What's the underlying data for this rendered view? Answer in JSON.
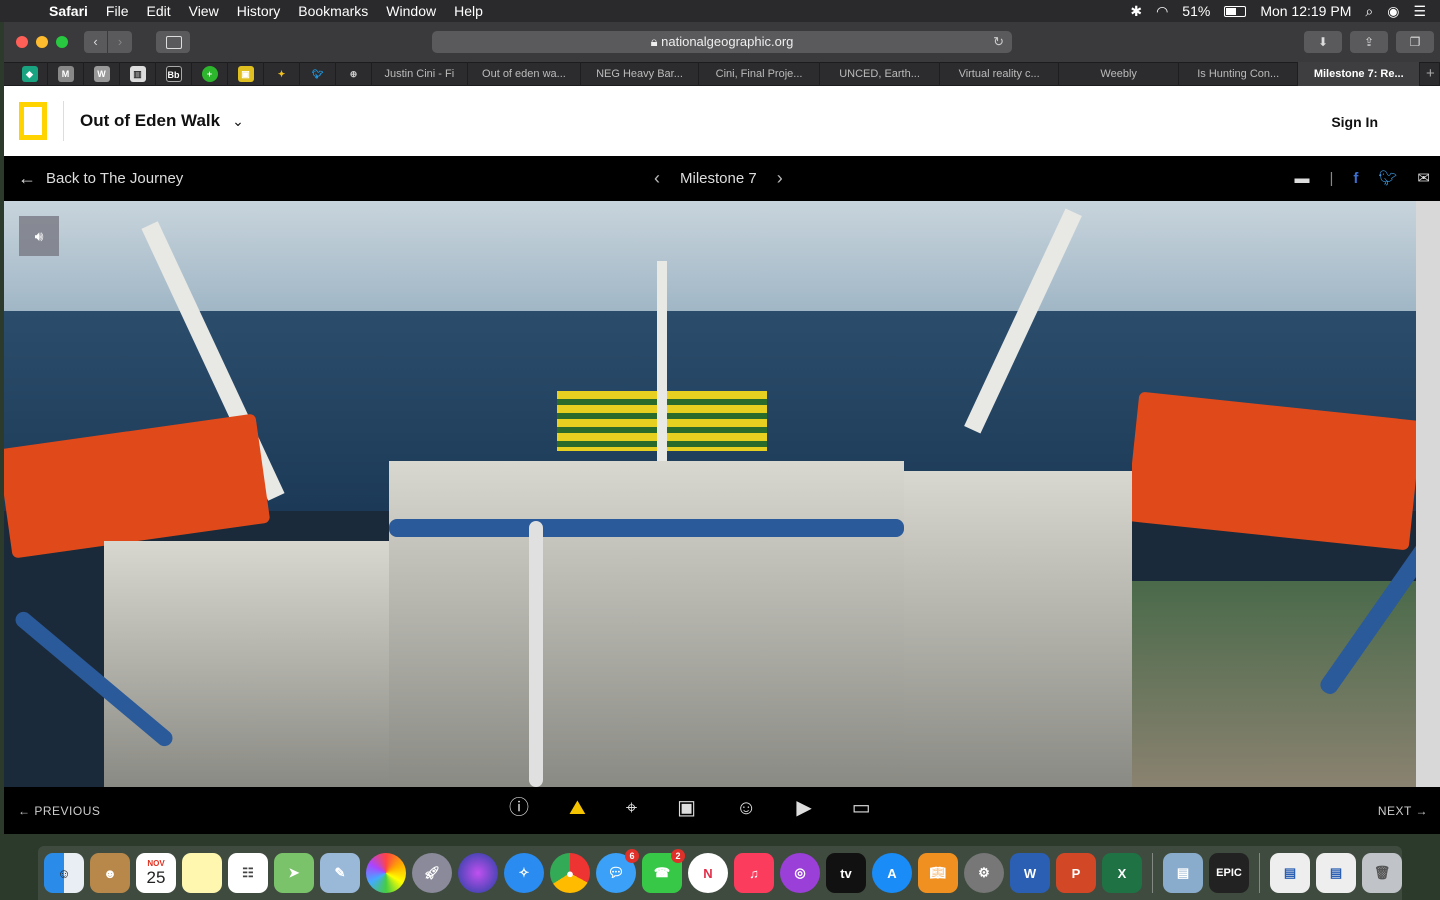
{
  "menubar": {
    "app": "Safari",
    "menus": [
      "File",
      "Edit",
      "View",
      "History",
      "Bookmarks",
      "Window",
      "Help"
    ],
    "battery": "51%",
    "clock": "Mon 12:19 PM"
  },
  "browser": {
    "url": "nationalgeographic.org",
    "tabs": [
      "Justin Cini - Fi",
      "Out of eden wa...",
      "NEG Heavy Bar...",
      "Cini, Final Proje...",
      "UNCED, Earth...",
      "Virtual reality c...",
      "Weebly",
      "Is Hunting Con...",
      "Milestone 7: Re..."
    ],
    "favorites": [
      "edu-icon",
      "M",
      "W",
      "wallet-icon",
      "Bb",
      "plus-icon",
      "image-icon",
      "puzzle-icon",
      "twitter-icon",
      "globe-icon"
    ]
  },
  "site": {
    "title": "Out of Eden Walk",
    "sign_in": "Sign In",
    "back": "Back to The Journey",
    "milestone": "Milestone 7",
    "previous": "PREVIOUS",
    "next": "NEXT"
  },
  "dock": {
    "calendar_month": "NOV",
    "calendar_day": "25",
    "messages_badge": "6",
    "facetime_badge": "2",
    "epic_label": "EPIC"
  },
  "colors": {
    "ng_yellow": "#ffd300",
    "active_tool": "#f5c400"
  }
}
